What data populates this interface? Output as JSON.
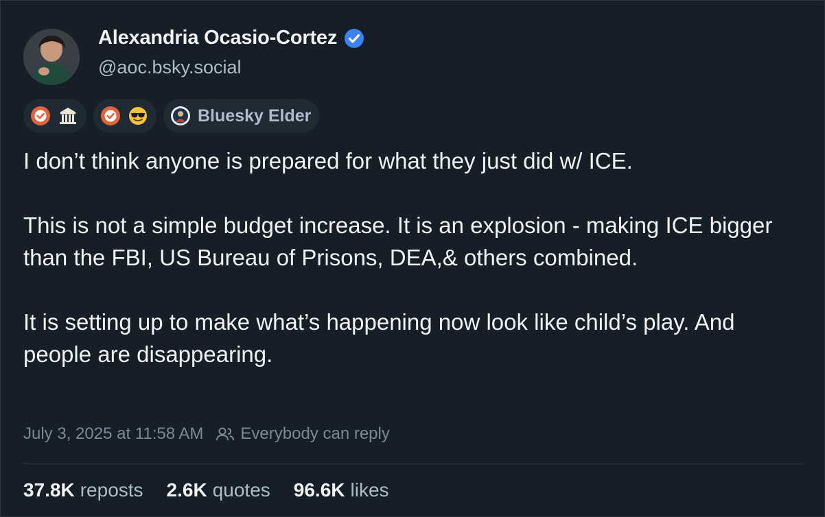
{
  "author": {
    "name": "Alexandria Ocasio-Cortez",
    "handle": "@aoc.bsky.social",
    "verified_color": "#3b82f6"
  },
  "badges": [
    {
      "icons": [
        "verified-check-icon",
        "government-building-icon"
      ]
    },
    {
      "icons": [
        "verified-check-icon",
        "sunglasses-emoji-icon"
      ]
    },
    {
      "icons": [
        "elder-avatar-icon"
      ],
      "label": "Bluesky Elder"
    }
  ],
  "post": {
    "paragraphs": [
      "I don’t think anyone is prepared for what they just did w/ ICE.",
      "This is not a simple budget increase. It is an explosion - making ICE bigger than the FBI, US Bureau of Prisons, DEA,& others combined.",
      "It is setting up to make what’s happening now look like child’s play. And people are disappearing."
    ],
    "timestamp": "July 3, 2025 at 11:58 AM",
    "reply_setting": "Everybody can reply"
  },
  "stats": {
    "reposts": {
      "count": "37.8K",
      "label": "reposts"
    },
    "quotes": {
      "count": "2.6K",
      "label": "quotes"
    },
    "likes": {
      "count": "96.6K",
      "label": "likes"
    }
  },
  "colors": {
    "background": "#161e27",
    "badge_check": "#e0643a",
    "muted_text": "#aebbc9"
  }
}
